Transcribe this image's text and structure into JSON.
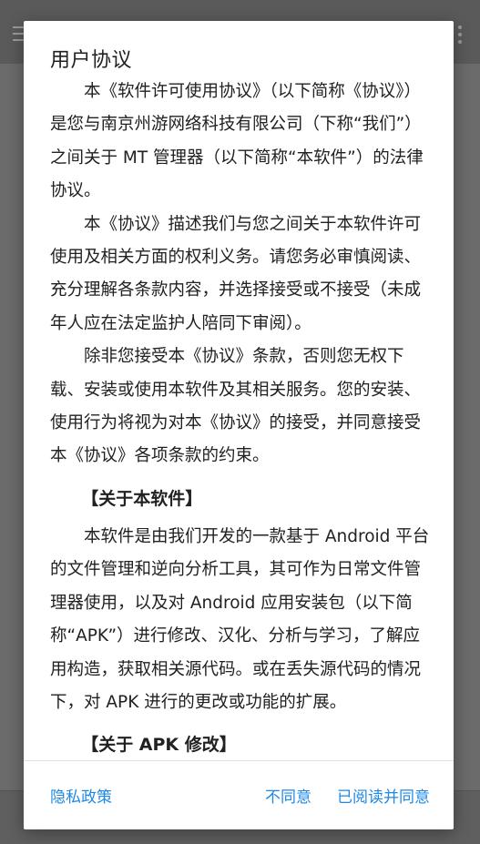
{
  "dialog": {
    "title": "用户协议",
    "paragraphs": [
      "本《软件许可使用协议》（以下简称《协议》）是您与南京州游网络科技有限公司（下称“我们”）之间关于 MT 管理器（以下简称“本软件”）的法律协议。",
      "本《协议》描述我们与您之间关于本软件许可使用及相关方面的权利义务。请您务必审慎阅读、充分理解各条款内容，并选择接受或不接受（未成年人应在法定监护人陪同下审阅）。",
      "除非您接受本《协议》条款，否则您无权下载、安装或使用本软件及其相关服务。您的安装、使用行为将视为对本《协议》的接受，并同意接受本《协议》各项条款的约束。"
    ],
    "section1_heading": "【关于本软件】",
    "section1_paragraph": "本软件是由我们开发的一款基于 Android 平台的文件管理和逆向分析工具，其可作为日常文件管理器使用，以及对 Android 应用安装包（以下简称“APK”）进行修改、汉化、分析与学习，了解应用构造，获取相关源代码。或在丢失源代码的情况下，对 APK 进行的更改或功能的扩展。",
    "section2_heading": "【关于 APK 修改】",
    "buttons": {
      "privacy": "隐私政策",
      "disagree": "不同意",
      "agree": "已阅读并同意"
    }
  },
  "colors": {
    "accent": "#1e88e5",
    "text": "#212121",
    "scrim": "#6b6b6b"
  },
  "icons": {
    "menu": "menu-icon",
    "more": "more-vert-icon"
  }
}
